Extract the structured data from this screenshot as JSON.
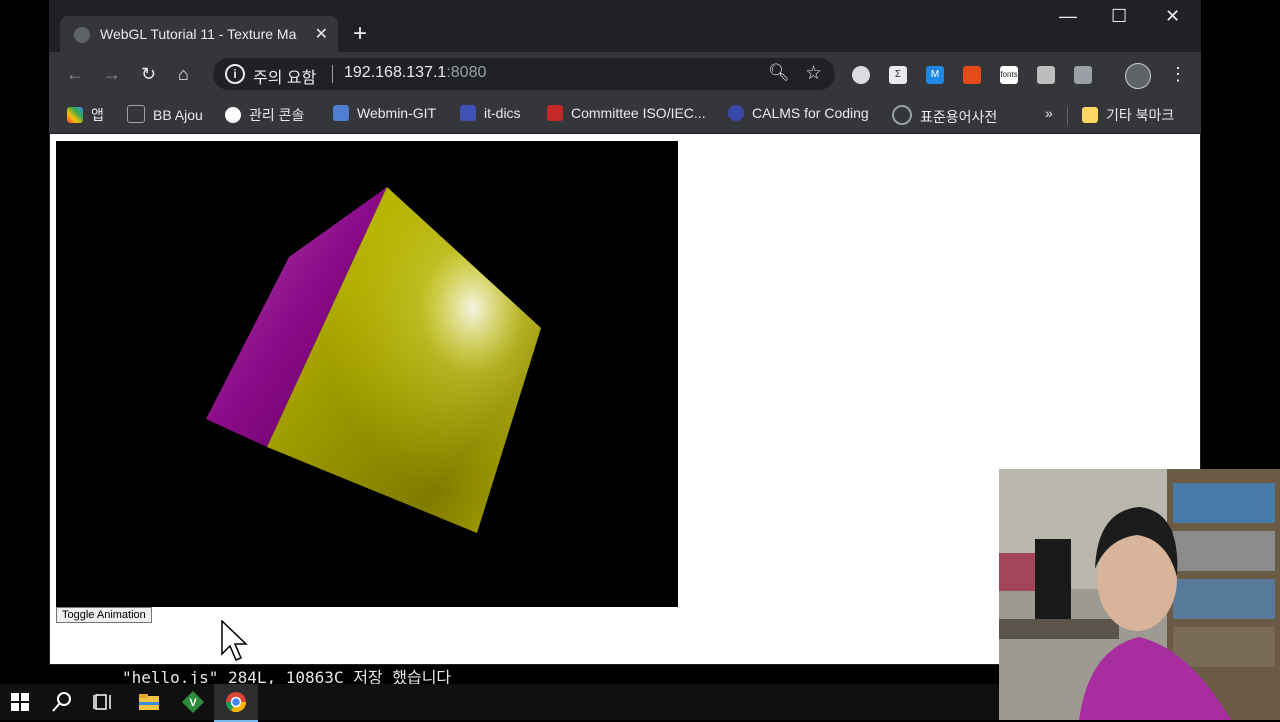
{
  "window": {
    "tab_title": "WebGL Tutorial 11 - Texture Ma",
    "tab_close": "✕",
    "new_tab": "+",
    "controls": {
      "minimize": "—",
      "maximize": "☐",
      "close": "✕"
    }
  },
  "toolbar": {
    "security_label": "주의 요함",
    "url_host": "192.168.137.1",
    "url_port": ":8080",
    "extension_fonts_label": "fonts",
    "extension_m_label": "M"
  },
  "bookmarks": {
    "items": [
      {
        "label": "앱",
        "icon": "apps-grid-icon",
        "color": "#e94235"
      },
      {
        "label": "BB Ajou",
        "icon": "blackboard-icon",
        "color": "#9aa0a6"
      },
      {
        "label": "관리 콘솔",
        "icon": "google-icon",
        "color": "#ffffff"
      },
      {
        "label": "Webmin-GIT",
        "icon": "webmin-icon",
        "color": "#4e7fd1"
      },
      {
        "label": "it-dics",
        "icon": "doc-icon",
        "color": "#3f51b5"
      },
      {
        "label": "Committee ISO/IEC...",
        "icon": "pf-icon",
        "color": "#c62828"
      },
      {
        "label": "CALMS for Coding",
        "icon": "calms-icon",
        "color": "#3949ab"
      },
      {
        "label": "표준용어사전",
        "icon": "dictionary-icon",
        "color": "#9aa0a6"
      }
    ],
    "overflow": "»",
    "other_bookmarks": "기타 북마크"
  },
  "page": {
    "toggle_button": "Toggle Animation"
  },
  "terminal": {
    "status_line": "\"hello.js\" 284L, 10863C 저장 했습니다"
  },
  "taskbar": {
    "items": [
      "windows-start-icon",
      "search-icon",
      "task-view-icon",
      "file-explorer-icon",
      "vim-icon",
      "chrome-icon"
    ]
  }
}
